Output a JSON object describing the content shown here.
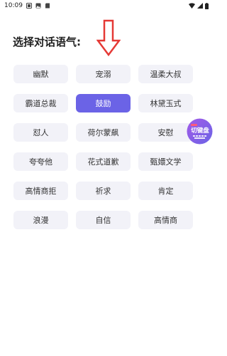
{
  "status_bar": {
    "time": "10:09"
  },
  "title": "选择对话语气:",
  "tones": [
    {
      "label": "幽默",
      "selected": false
    },
    {
      "label": "宠溺",
      "selected": false
    },
    {
      "label": "温柔大叔",
      "selected": false
    },
    {
      "label": "霸道总裁",
      "selected": false
    },
    {
      "label": "鼓励",
      "selected": true
    },
    {
      "label": "林黛玉式",
      "selected": false
    },
    {
      "label": "怼人",
      "selected": false
    },
    {
      "label": "荷尔蒙飙",
      "selected": false
    },
    {
      "label": "安慰",
      "selected": false
    },
    {
      "label": "夸夸他",
      "selected": false
    },
    {
      "label": "花式道歉",
      "selected": false
    },
    {
      "label": "甄嬛文学",
      "selected": false
    },
    {
      "label": "高情商拒",
      "selected": false
    },
    {
      "label": "祈求",
      "selected": false
    },
    {
      "label": "肯定",
      "selected": false
    },
    {
      "label": "浪漫",
      "selected": false
    },
    {
      "label": "自信",
      "selected": false
    },
    {
      "label": "高情商",
      "selected": false
    }
  ],
  "floating_button": {
    "label": "切键盘"
  },
  "colors": {
    "accent": "#6b63e6",
    "chip_bg": "#f2f2f8",
    "arrow": "#e53935"
  }
}
